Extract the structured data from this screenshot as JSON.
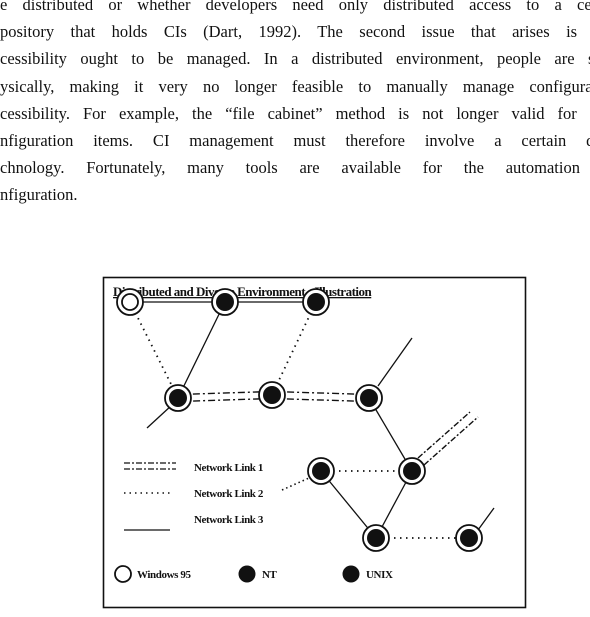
{
  "document": {
    "paragraph_lines": [
      "e distributed or whether developers need only distributed access to a centr",
      "pository that holds CIs (Dart, 1992).  The second issue that arises is ho",
      "cessibility ought to be managed.  In a distributed environment, people are sep",
      "ysically, making it very no longer feasible to manually manage configuratio",
      "cessibility.  For example, the “file cabinet” method is not longer valid for ma",
      "nfiguration items.   CI management must therefore involve a certain deg",
      "chnology.   Fortunately, many tools are available for the automation o",
      "nfiguration."
    ]
  },
  "figure": {
    "title": "Distributed and Diverse Environment - Illustration",
    "legend_links": [
      {
        "label": "Network Link 1",
        "style": "dash-dot-double"
      },
      {
        "label": "Network Link 2",
        "style": "dotted"
      },
      {
        "label": "Network Link 3",
        "style": "solid"
      }
    ],
    "legend_os": [
      {
        "label": "Windows 95",
        "symbol": "open-circle"
      },
      {
        "label": "NT",
        "symbol": "filled-circle"
      },
      {
        "label": "UNIX",
        "symbol": "filled-circle"
      }
    ],
    "nodes": [
      {
        "id": "n1",
        "os": "Windows 95"
      },
      {
        "id": "n2",
        "os": "NT"
      },
      {
        "id": "n3",
        "os": "NT"
      },
      {
        "id": "n4",
        "os": "NT"
      },
      {
        "id": "n5",
        "os": "NT"
      },
      {
        "id": "n6",
        "os": "NT"
      },
      {
        "id": "n7",
        "os": "NT"
      },
      {
        "id": "n8",
        "os": "NT"
      },
      {
        "id": "n9",
        "os": "NT"
      },
      {
        "id": "n10",
        "os": "NT"
      }
    ],
    "links": [
      {
        "from": "n1",
        "to": "n2",
        "type": "Network Link 3"
      },
      {
        "from": "n2",
        "to": "n3",
        "type": "Network Link 3"
      },
      {
        "from": "n1",
        "to": "n4",
        "type": "Network Link 2"
      },
      {
        "from": "n2",
        "to": "n4",
        "type": "Network Link 3"
      },
      {
        "from": "n3",
        "to": "n5",
        "type": "Network Link 2"
      },
      {
        "from": "n4",
        "to": "n5",
        "type": "Network Link 1"
      },
      {
        "from": "n5",
        "to": "n6",
        "type": "Network Link 1"
      },
      {
        "from": "n6",
        "to": "n8",
        "type": "Network Link 3"
      },
      {
        "from": "n7",
        "to": "n8",
        "type": "Network Link 2"
      },
      {
        "from": "n7",
        "to": "n9",
        "type": "Network Link 3"
      },
      {
        "from": "n8",
        "to": "n9",
        "type": "Network Link 3"
      },
      {
        "from": "n9",
        "to": "n10",
        "type": "Network Link 2"
      }
    ]
  }
}
